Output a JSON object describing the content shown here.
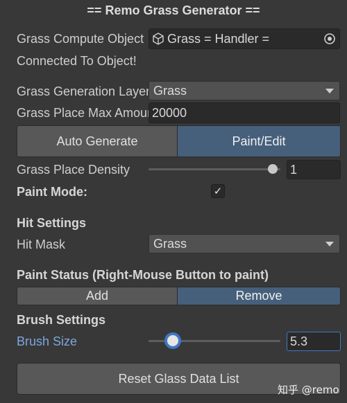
{
  "header": {
    "title": "== Remo Grass Generator =="
  },
  "compute_object": {
    "label": "Grass Compute Object",
    "value": "Grass = Handler =",
    "status": "Connected To Object!"
  },
  "generation_layer": {
    "label": "Grass Generation Layer",
    "value": "Grass"
  },
  "place_max": {
    "label": "Grass Place Max Amount",
    "value": "20000"
  },
  "mode_tabs": {
    "items": [
      {
        "label": "Auto Generate",
        "active": false
      },
      {
        "label": "Paint/Edit",
        "active": true
      }
    ]
  },
  "density": {
    "label": "Grass Place Density",
    "value": "1",
    "fraction": 1.0
  },
  "paint_mode": {
    "label": "Paint Mode:",
    "checked": true,
    "check_glyph": "✓"
  },
  "hit_settings": {
    "heading": "Hit Settings",
    "mask_label": "Hit Mask",
    "mask_value": "Grass"
  },
  "paint_status": {
    "heading": "Paint Status (Right-Mouse Button to paint)",
    "items": [
      {
        "label": "Add",
        "active": false
      },
      {
        "label": "Remove",
        "active": true
      }
    ]
  },
  "brush": {
    "heading": "Brush Settings",
    "size_label": "Brush Size",
    "size_value": "5.3",
    "fraction": 0.053
  },
  "reset_button": {
    "label": "Reset Glass Data List"
  },
  "watermark": {
    "text": "知乎 @remo"
  },
  "colors": {
    "background": "#383838",
    "active_tab": "#46607c",
    "focus_ring": "#3f78c4",
    "link_label": "#7ea6dc"
  },
  "icons": {
    "object_field": "cube-icon",
    "object_picker": "target-icon",
    "dropdown": "chevron-down-icon"
  }
}
